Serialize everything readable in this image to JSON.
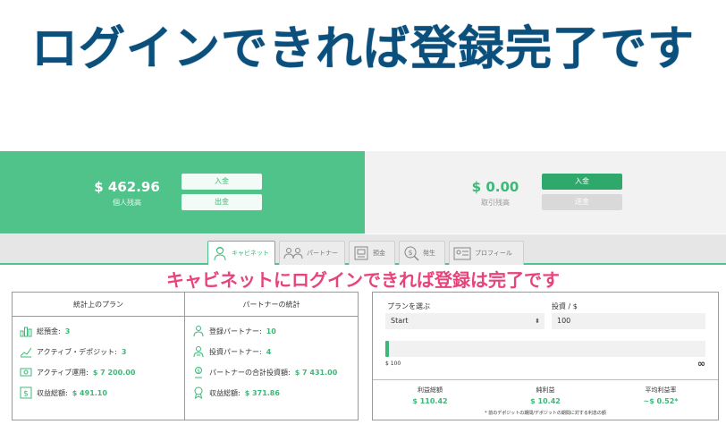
{
  "headline": "ログインできれば登録完了です",
  "balances": {
    "personal": {
      "amount": "$ 462.96",
      "label": "個人残高",
      "deposit_label": "入金",
      "withdraw_label": "出金"
    },
    "trading": {
      "amount": "$ 0.00",
      "label": "取引残高",
      "deposit_label": "入金",
      "withdraw_label": "送金"
    }
  },
  "tabs": [
    {
      "label": "キャビネット",
      "icon": "user-worker-icon"
    },
    {
      "label": "パートナー",
      "icon": "partners-icon"
    },
    {
      "label": "預金",
      "icon": "deposit-icon"
    },
    {
      "label": "発生",
      "icon": "dollar-search-icon"
    },
    {
      "label": "プロフィール",
      "icon": "profile-card-icon"
    }
  ],
  "overlay_caption": "キャビネットにログインできれば登録は完了です",
  "stats": {
    "plan_title": "統計上のプラン",
    "partner_title": "パートナーの統計",
    "plan_rows": [
      {
        "label": "総預金:",
        "value": "3",
        "icon": "bar-chart-icon"
      },
      {
        "label": "アクティブ・デポジット:",
        "value": "3",
        "icon": "trend-chart-icon"
      },
      {
        "label": "アクティブ運用:",
        "value": "$ 7 200.00",
        "icon": "money-icon"
      },
      {
        "label": "収益総額:",
        "value": "$ 491.10",
        "icon": "dollar-box-icon"
      }
    ],
    "partner_rows": [
      {
        "label": "登録パートナー:",
        "value": "10",
        "icon": "partners-icon"
      },
      {
        "label": "投資パートナー:",
        "value": "4",
        "icon": "investor-icon"
      },
      {
        "label": "パートナーの合計投資額:",
        "value": "$ 7 431.00",
        "icon": "partner-invest-icon"
      },
      {
        "label": "収益総額:",
        "value": "$ 371.86",
        "icon": "award-icon"
      }
    ]
  },
  "calculator": {
    "plan_label": "プランを選ぶ",
    "plan_value": "Start",
    "invest_label": "投資 / $",
    "invest_value": "100",
    "slider_min": "$ 100",
    "slider_max": "∞",
    "slider_level": 0,
    "results": [
      {
        "label": "利益総額",
        "value": "$ 110.42"
      },
      {
        "label": "純利益",
        "value": "$ 10.42"
      },
      {
        "label": "平均利益率",
        "value": "~$ 0.52*"
      }
    ],
    "note": "* 前のデポジットの期間/デポジットの期間に対する利息の額"
  },
  "colors": {
    "brand_green": "#4fc38a",
    "value_green": "#3cb878",
    "headline_blue": "#0b4f7c",
    "caption_pink": "#e8437b"
  }
}
